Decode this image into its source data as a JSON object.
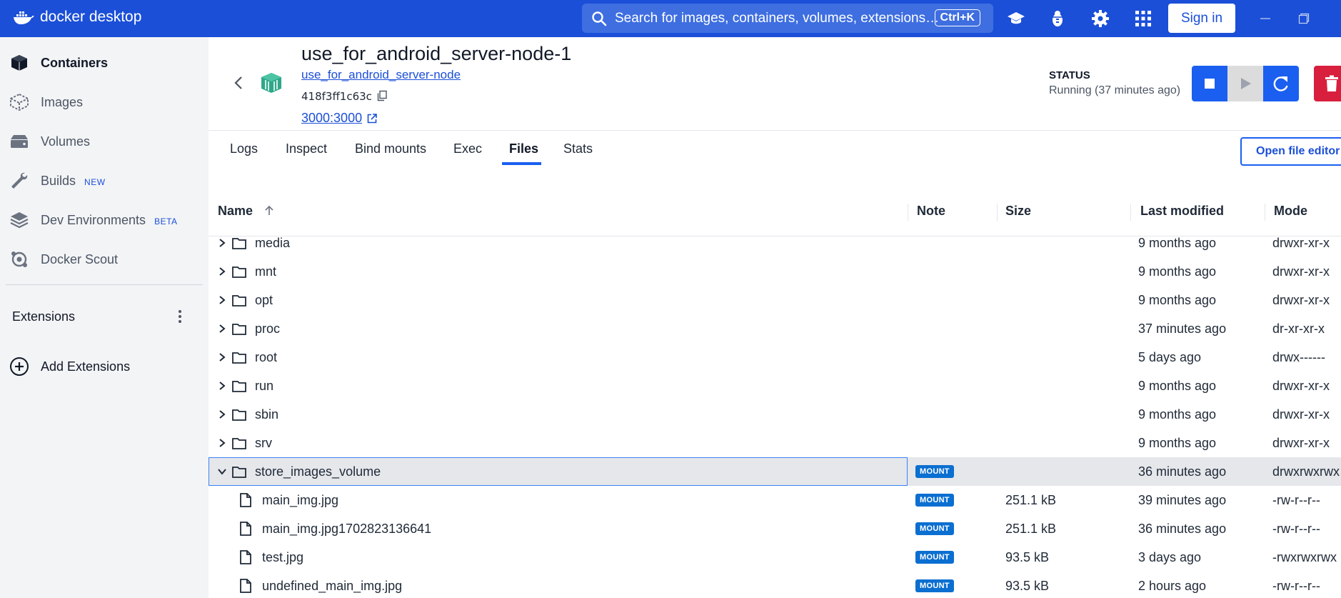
{
  "topbar": {
    "brand": "docker desktop",
    "search_placeholder": "Search for images, containers, volumes, extensions…",
    "shortcut": "Ctrl+K",
    "sign_in": "Sign in"
  },
  "sidebar": {
    "items": [
      {
        "label": "Containers",
        "icon": "container-icon"
      },
      {
        "label": "Images",
        "icon": "images-icon"
      },
      {
        "label": "Volumes",
        "icon": "volumes-icon"
      },
      {
        "label": "Builds",
        "badge": "NEW",
        "icon": "wrench-icon"
      },
      {
        "label": "Dev Environments",
        "badge": "BETA",
        "icon": "dev-env-icon"
      },
      {
        "label": "Docker Scout",
        "icon": "scout-icon"
      }
    ],
    "extensions_label": "Extensions",
    "add_extensions": "Add Extensions"
  },
  "container": {
    "name": "use_for_android_server-node-1",
    "image_link": "use_for_android_server-node",
    "id": "418f3ff1c63c",
    "port": "3000:3000",
    "status_label": "STATUS",
    "status_value": "Running (37 minutes ago)"
  },
  "tabs": [
    "Logs",
    "Inspect",
    "Bind mounts",
    "Exec",
    "Files",
    "Stats"
  ],
  "active_tab": "Files",
  "open_file_editor": "Open file editor",
  "table": {
    "headers": {
      "name": "Name",
      "note": "Note",
      "size": "Size",
      "modified": "Last modified",
      "mode": "Mode"
    },
    "rows": [
      {
        "name": "media",
        "type": "folder",
        "note": "",
        "size": "",
        "modified": "9 months ago",
        "mode": "drwxr-xr-x"
      },
      {
        "name": "mnt",
        "type": "folder",
        "note": "",
        "size": "",
        "modified": "9 months ago",
        "mode": "drwxr-xr-x"
      },
      {
        "name": "opt",
        "type": "folder",
        "note": "",
        "size": "",
        "modified": "9 months ago",
        "mode": "drwxr-xr-x"
      },
      {
        "name": "proc",
        "type": "folder",
        "note": "",
        "size": "",
        "modified": "37 minutes ago",
        "mode": "dr-xr-xr-x"
      },
      {
        "name": "root",
        "type": "folder",
        "note": "",
        "size": "",
        "modified": "5 days ago",
        "mode": "drwx------"
      },
      {
        "name": "run",
        "type": "folder",
        "note": "",
        "size": "",
        "modified": "9 months ago",
        "mode": "drwxr-xr-x"
      },
      {
        "name": "sbin",
        "type": "folder",
        "note": "",
        "size": "",
        "modified": "9 months ago",
        "mode": "drwxr-xr-x"
      },
      {
        "name": "srv",
        "type": "folder",
        "note": "",
        "size": "",
        "modified": "9 months ago",
        "mode": "drwxr-xr-x"
      },
      {
        "name": "store_images_volume",
        "type": "folder-open",
        "note": "MOUNT",
        "size": "",
        "modified": "36 minutes ago",
        "mode": "drwxrwxrwx"
      },
      {
        "name": "main_img.jpg",
        "type": "file",
        "note": "MOUNT",
        "size": "251.1 kB",
        "modified": "39 minutes ago",
        "mode": "-rw-r--r--"
      },
      {
        "name": "main_img.jpg1702823136641",
        "type": "file",
        "note": "MOUNT",
        "size": "251.1 kB",
        "modified": "36 minutes ago",
        "mode": "-rw-r--r--"
      },
      {
        "name": "test.jpg",
        "type": "file",
        "note": "MOUNT",
        "size": "93.5 kB",
        "modified": "3 days ago",
        "mode": "-rwxrwxrwx"
      },
      {
        "name": "undefined_main_img.jpg",
        "type": "file",
        "note": "MOUNT",
        "size": "93.5 kB",
        "modified": "2 hours ago",
        "mode": "-rw-r--r--"
      }
    ]
  },
  "colors": {
    "brand_blue": "#1b4fd8",
    "action_blue": "#1b5ff0",
    "danger": "#d91f3e",
    "mount_badge": "#0b6fd1"
  }
}
